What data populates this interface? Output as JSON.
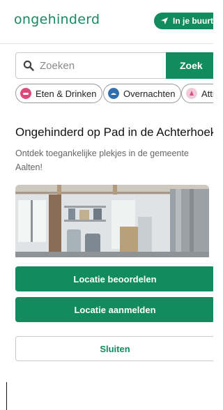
{
  "header": {
    "logo_text": "ongehinderd",
    "near_me_label": "In je buurt",
    "near_me_icon": "navigation-arrow-icon"
  },
  "search": {
    "placeholder": "Zoeken",
    "value": "",
    "button_label": "Zoek",
    "icon": "search-icon"
  },
  "categories": [
    {
      "label": "Eten & Drinken",
      "icon": "food-icon",
      "color": "#e0457b"
    },
    {
      "label": "Overnachten",
      "icon": "bed-icon",
      "color": "#2f6fb0"
    },
    {
      "label": "Attracties",
      "icon": "attraction-icon",
      "color": "#d84e8a"
    }
  ],
  "content": {
    "title": "Ongehinderd op Pad in de Achterhoek",
    "description": "Ontdek toegankelijke plekjes in de gemeente Aalten!"
  },
  "sheet": {
    "rate_label": "Locatie beoordelen",
    "register_label": "Locatie aanmelden",
    "close_label": "Sluiten"
  },
  "colors": {
    "brand_green": "#128c5e",
    "logo_green": "#158a5f"
  }
}
